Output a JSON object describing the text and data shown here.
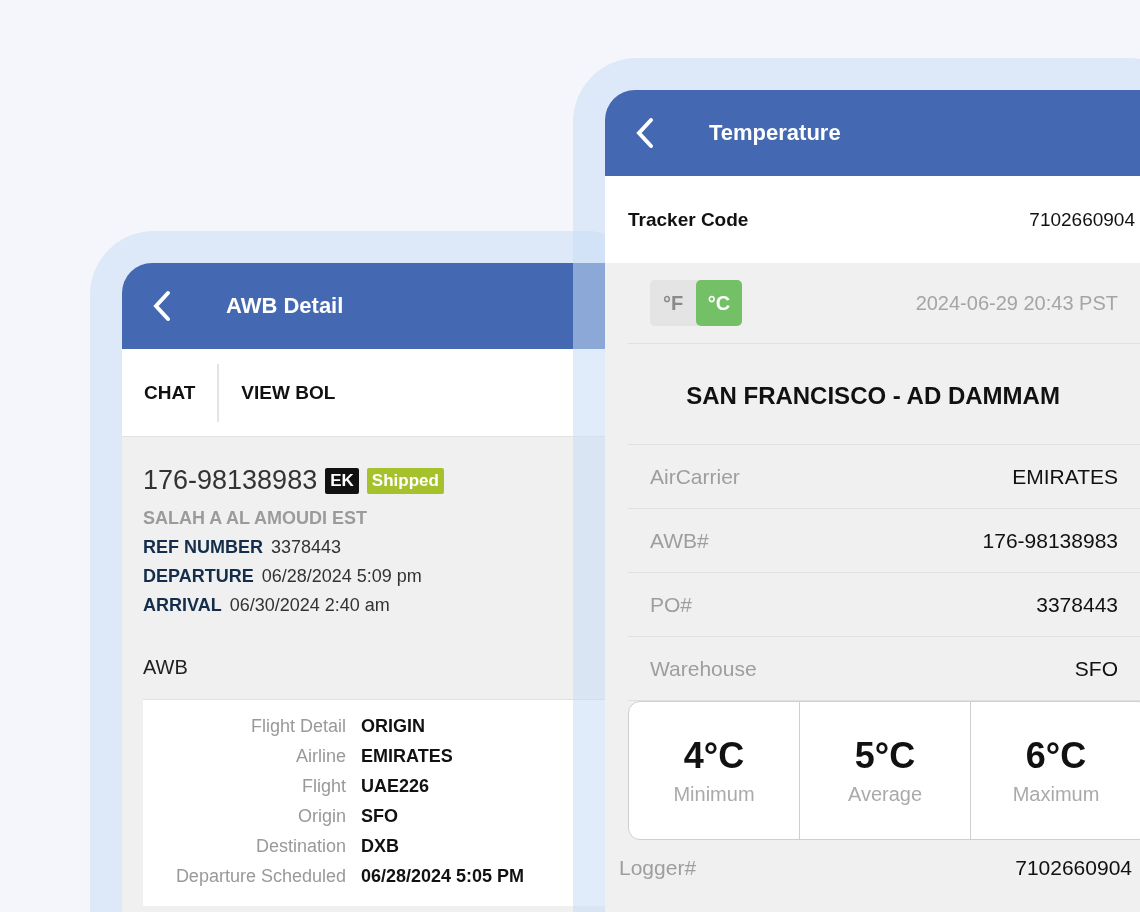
{
  "awb_detail": {
    "title": "AWB Detail",
    "actions": [
      {
        "label": "CHAT"
      },
      {
        "label": "VIEW BOL"
      }
    ],
    "awb_number": "176-98138983",
    "badges": [
      {
        "label": "EK",
        "color": "#111111"
      },
      {
        "label": "Shipped",
        "color": "#a5c12c"
      }
    ],
    "company": "SALAH A AL AMOUDI EST",
    "fields": [
      {
        "label": "REF NUMBER",
        "value": "3378443"
      },
      {
        "label": "DEPARTURE",
        "value": "06/28/2024 5:09 pm"
      },
      {
        "label": "ARRIVAL",
        "value": "06/30/2024 2:40 am"
      }
    ],
    "section_title": "AWB",
    "flight_details": [
      {
        "label": "Flight Detail",
        "value": "ORIGIN"
      },
      {
        "label": "Airline",
        "value": "EMIRATES"
      },
      {
        "label": "Flight",
        "value": "UAE226"
      },
      {
        "label": "Origin",
        "value": "SFO"
      },
      {
        "label": "Destination",
        "value": "DXB"
      },
      {
        "label": "Departure Scheduled",
        "value": "06/28/2024 5:05 PM"
      }
    ]
  },
  "temperature": {
    "title": "Temperature",
    "tracker": {
      "label": "Tracker Code",
      "value": "7102660904"
    },
    "units": [
      {
        "label": "°F",
        "selected": false
      },
      {
        "label": "°C",
        "selected": true
      }
    ],
    "timestamp": "2024-06-29 20:43 PST",
    "route": "SAN FRANCISCO - AD DAMMAM",
    "details": [
      {
        "label": "AirCarrier",
        "value": "EMIRATES"
      },
      {
        "label": "AWB#",
        "value": "176-98138983"
      },
      {
        "label": "PO#",
        "value": "3378443"
      },
      {
        "label": "Warehouse",
        "value": "SFO"
      }
    ],
    "stats": [
      {
        "value": "4°C",
        "label": "Minimum"
      },
      {
        "value": "5°C",
        "label": "Average"
      },
      {
        "value": "6°C",
        "label": "Maximum"
      }
    ],
    "logger": {
      "label": "Logger#",
      "value": "7102660904"
    }
  }
}
